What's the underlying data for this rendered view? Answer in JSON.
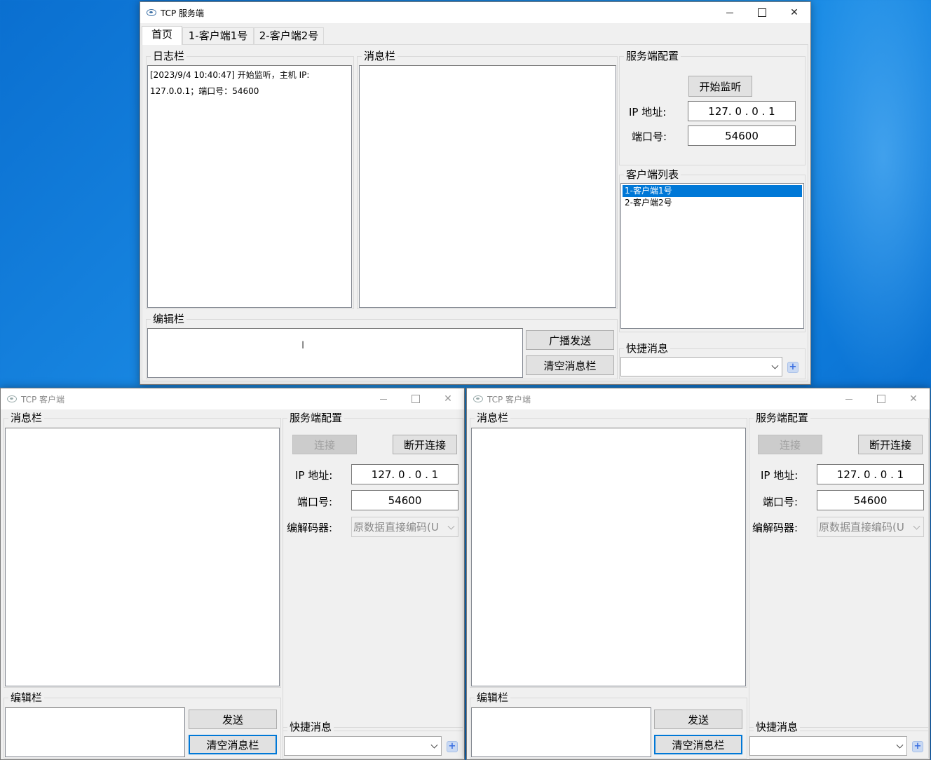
{
  "server": {
    "title": "TCP 服务端",
    "tabs": [
      {
        "label": "首页"
      },
      {
        "label": "1-客户端1号"
      },
      {
        "label": "2-客户端2号"
      }
    ],
    "log_group": "日志栏",
    "log_lines": [
      "[2023/9/4 10:40:47] 开始监听，主机 IP:",
      "127.0.0.1；端口号：54600"
    ],
    "message_group": "消息栏",
    "config_group": "服务端配置",
    "start_button": "开始监听",
    "ip_label": "IP 地址:",
    "ip_value": "127. 0 . 0 . 1",
    "port_label": "端口号:",
    "port_value": "54600",
    "client_list_group": "客户端列表",
    "client_list": [
      "1-客户端1号",
      "2-客户端2号"
    ],
    "edit_group": "编辑栏",
    "broadcast_button": "广播发送",
    "clear_button": "清空消息栏",
    "quick_group": "快捷消息",
    "quick_value": "",
    "add_button": "+"
  },
  "clients": [
    {
      "title": "TCP 客户端",
      "message_group": "消息栏",
      "config_group": "服务端配置",
      "connect_button": "连接",
      "disconnect_button": "断开连接",
      "ip_label": "IP 地址:",
      "ip_value": "127. 0 . 0 . 1",
      "port_label": "端口号:",
      "port_value": "54600",
      "codec_label": "编解码器:",
      "codec_value": "原数据直接编码(U",
      "edit_group": "编辑栏",
      "send_button": "发送",
      "clear_button": "清空消息栏",
      "quick_group": "快捷消息",
      "quick_value": "",
      "add_button": "+"
    },
    {
      "title": "TCP 客户端",
      "message_group": "消息栏",
      "config_group": "服务端配置",
      "connect_button": "连接",
      "disconnect_button": "断开连接",
      "ip_label": "IP 地址:",
      "ip_value": "127. 0 . 0 . 1",
      "port_label": "端口号:",
      "port_value": "54600",
      "codec_label": "编解码器:",
      "codec_value": "原数据直接编码(U",
      "edit_group": "编辑栏",
      "send_button": "发送",
      "clear_button": "清空消息栏",
      "quick_group": "快捷消息",
      "quick_value": "",
      "add_button": "+"
    }
  ],
  "colors": {
    "desktop": "#0a6fd0",
    "selection": "#0078d7",
    "window_bg": "#f0f0f0"
  }
}
